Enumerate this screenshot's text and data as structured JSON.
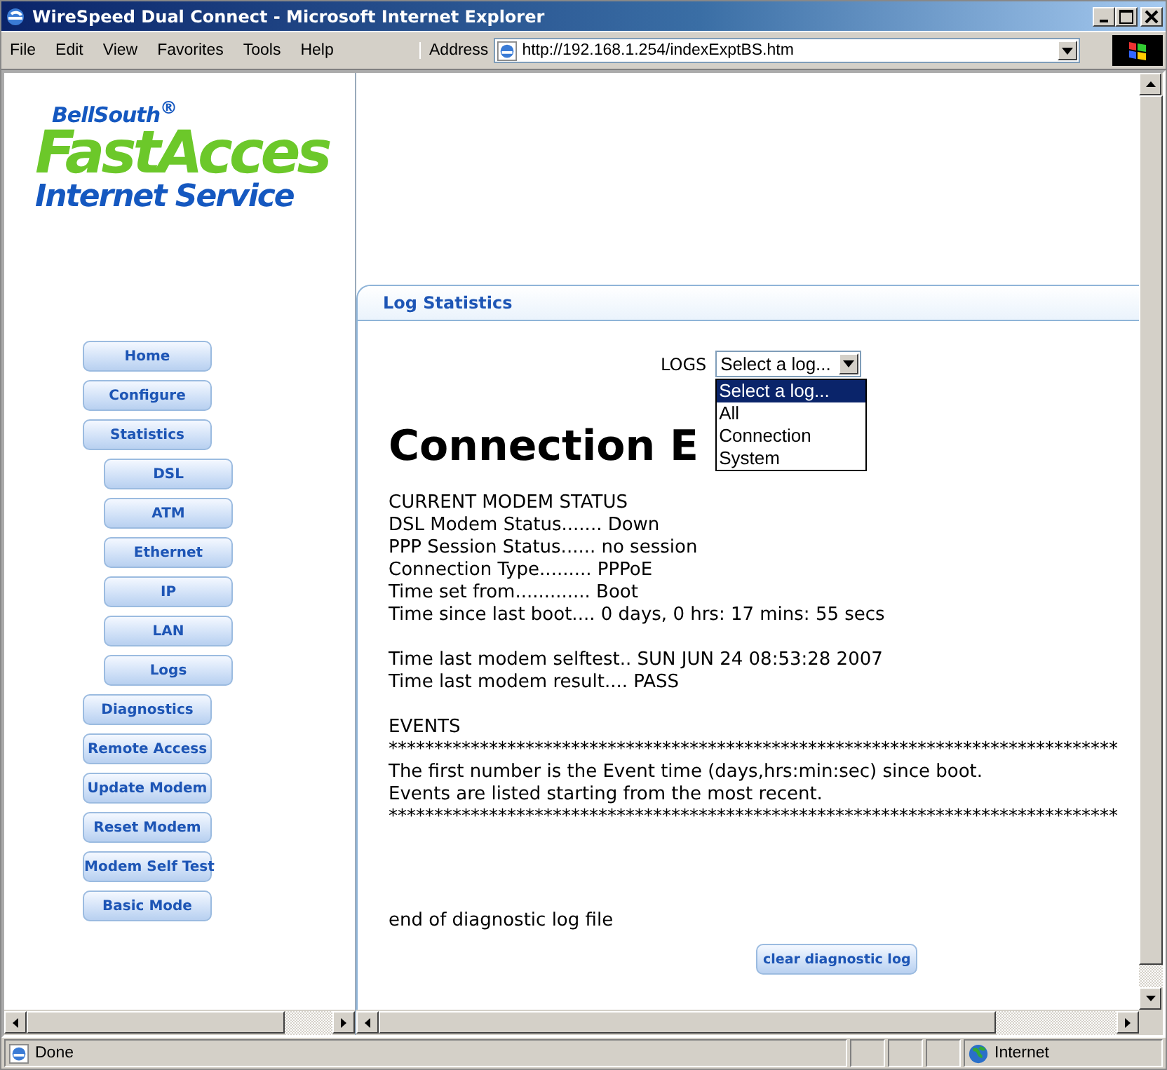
{
  "window": {
    "title": "WireSpeed Dual Connect - Microsoft Internet Explorer"
  },
  "menu": [
    "File",
    "Edit",
    "View",
    "Favorites",
    "Tools",
    "Help"
  ],
  "address": {
    "label": "Address",
    "url": "http://192.168.1.254/indexExptBS.htm"
  },
  "logo": {
    "brand": "BellSouth",
    "mark": "®",
    "product": "FastAcces",
    "tagline": "Internet Service"
  },
  "nav": [
    {
      "label": "Home"
    },
    {
      "label": "Configure"
    },
    {
      "label": "Statistics",
      "children": [
        {
          "label": "DSL"
        },
        {
          "label": "ATM"
        },
        {
          "label": "Ethernet"
        },
        {
          "label": "IP"
        },
        {
          "label": "LAN"
        },
        {
          "label": "Logs"
        }
      ]
    },
    {
      "label": "Diagnostics"
    },
    {
      "label": "Remote Access"
    },
    {
      "label": "Update Modem"
    },
    {
      "label": "Reset Modem"
    },
    {
      "label": "Modem Self Test"
    },
    {
      "label": "Basic Mode"
    }
  ],
  "panel": {
    "title": "Log Statistics",
    "logs_select": {
      "label": "LOGS",
      "value": "Select a log...",
      "expanded": true,
      "options": [
        {
          "label": "Select a log...",
          "selected": true
        },
        {
          "label": "All",
          "selected": false
        },
        {
          "label": "Connection",
          "selected": false
        },
        {
          "label": "System",
          "selected": false
        }
      ]
    },
    "heading": "Connection E",
    "blocks": [
      [
        "CURRENT MODEM STATUS",
        "DSL Modem Status....... Down",
        "PPP Session Status...... no session",
        "Connection Type......... PPPoE",
        "Time set from............. Boot",
        "Time since last boot.... 0 days, 0 hrs: 17 mins: 55 secs"
      ],
      [
        "Time last modem selftest.. SUN JUN 24 08:53:28 2007",
        "Time last modem result.... PASS"
      ],
      [
        "EVENTS",
        "********************************************************************************",
        "The first number is the Event time (days,hrs:min:sec) since boot.",
        "Events are listed starting from the most recent.",
        "********************************************************************************"
      ]
    ],
    "footer": "end of diagnostic log file",
    "button": "clear diagnostic log"
  },
  "status_bar": {
    "text": "Done",
    "zone": "Internet"
  }
}
